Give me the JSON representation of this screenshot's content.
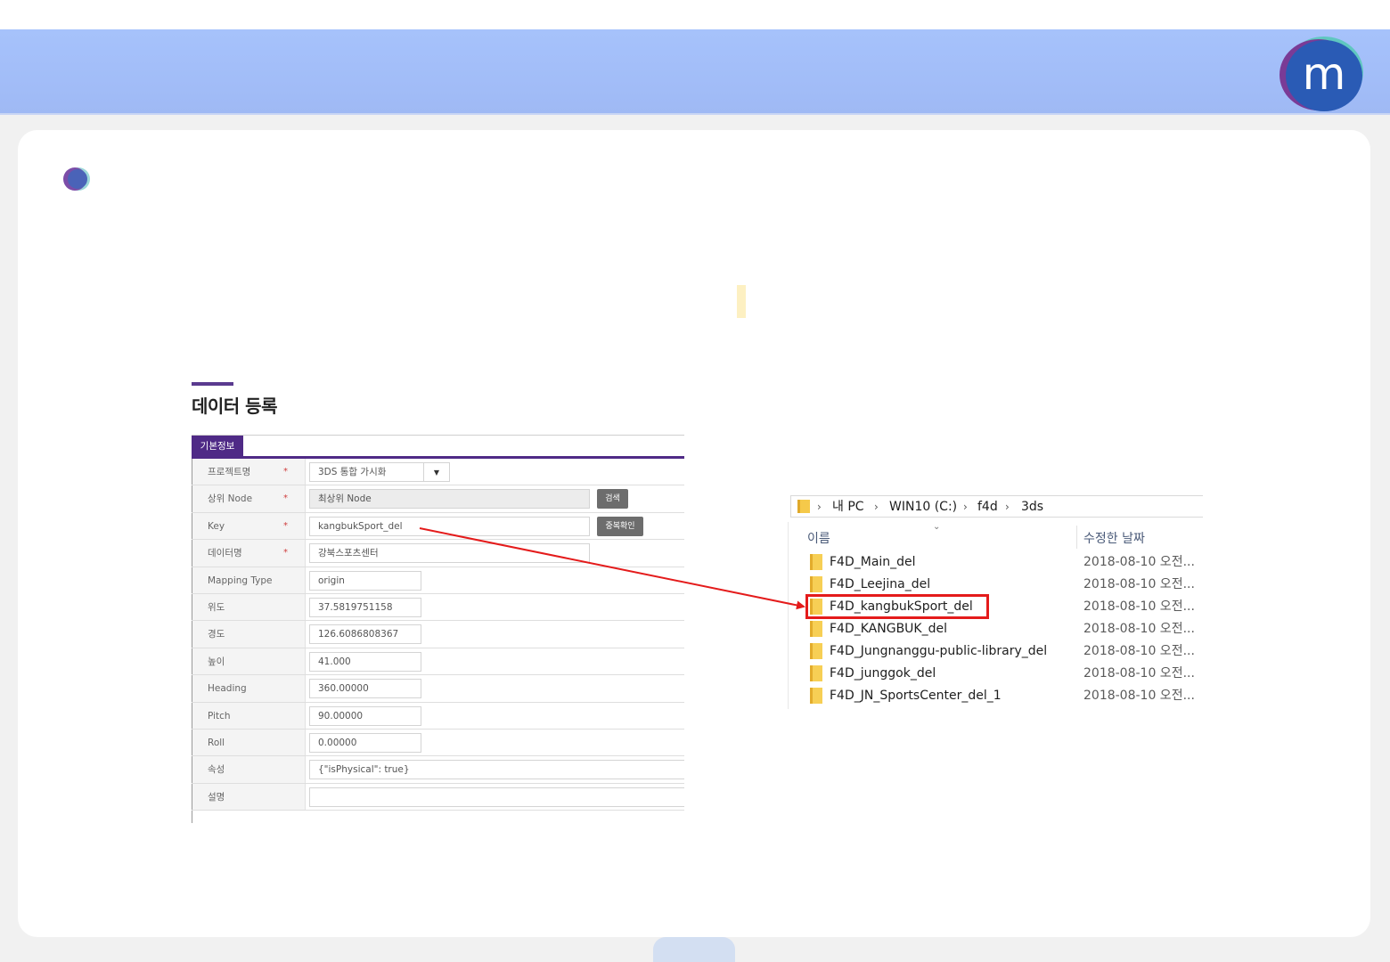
{
  "colors": {
    "header": "#a6c2fb",
    "form_accent": "#4f2a86",
    "highlight": "#e41b1b",
    "arrow": "#e41b1b",
    "yellow_mark": "#fdf0c2"
  },
  "logo": {
    "letter": "m"
  },
  "form": {
    "section_title": "데이터 등록",
    "tab_label": "기본정보",
    "rows": [
      {
        "label": "프로젝트명",
        "required": "*",
        "value": "3DS 통합 가시화",
        "type": "select"
      },
      {
        "label": "상위 Node",
        "required": "*",
        "value": "최상위 Node",
        "type": "readonly",
        "button": "검색"
      },
      {
        "label": "Key",
        "required": "*",
        "value": "kangbukSport_del",
        "type": "text",
        "button": "중복확인"
      },
      {
        "label": "데이터명",
        "required": "*",
        "value": "강북스포츠센터",
        "type": "text"
      },
      {
        "label": "Mapping Type",
        "value": "origin",
        "type": "short"
      },
      {
        "label": "위도",
        "value": "37.5819751158",
        "type": "short"
      },
      {
        "label": "경도",
        "value": "126.6086808367",
        "type": "short"
      },
      {
        "label": "높이",
        "value": "41.000",
        "type": "short"
      },
      {
        "label": "Heading",
        "value": "360.00000",
        "type": "short"
      },
      {
        "label": "Pitch",
        "value": "90.00000",
        "type": "short"
      },
      {
        "label": "Roll",
        "value": "0.00000",
        "type": "short"
      },
      {
        "label": "속성",
        "value": "{\"isPhysical\": true}",
        "type": "wide"
      },
      {
        "label": "설명",
        "value": "",
        "type": "wide"
      }
    ]
  },
  "explorer": {
    "breadcrumb": [
      "내 PC",
      "WIN10 (C:)",
      "f4d",
      "3ds"
    ],
    "columns": {
      "name": "이름",
      "date": "수정한 날짜"
    },
    "files": [
      {
        "name": "F4D_Main_del",
        "date": "2018-08-10 오전..."
      },
      {
        "name": "F4D_Leejina_del",
        "date": "2018-08-10 오전..."
      },
      {
        "name": "F4D_kangbukSport_del",
        "date": "2018-08-10 오전...",
        "highlighted": true
      },
      {
        "name": "F4D_KANGBUK_del",
        "date": "2018-08-10 오전..."
      },
      {
        "name": "F4D_Jungnanggu-public-library_del",
        "date": "2018-08-10 오전..."
      },
      {
        "name": "F4D_junggok_del",
        "date": "2018-08-10 오전..."
      },
      {
        "name": "F4D_JN_SportsCenter_del_1",
        "date": "2018-08-10 오전..."
      }
    ]
  }
}
